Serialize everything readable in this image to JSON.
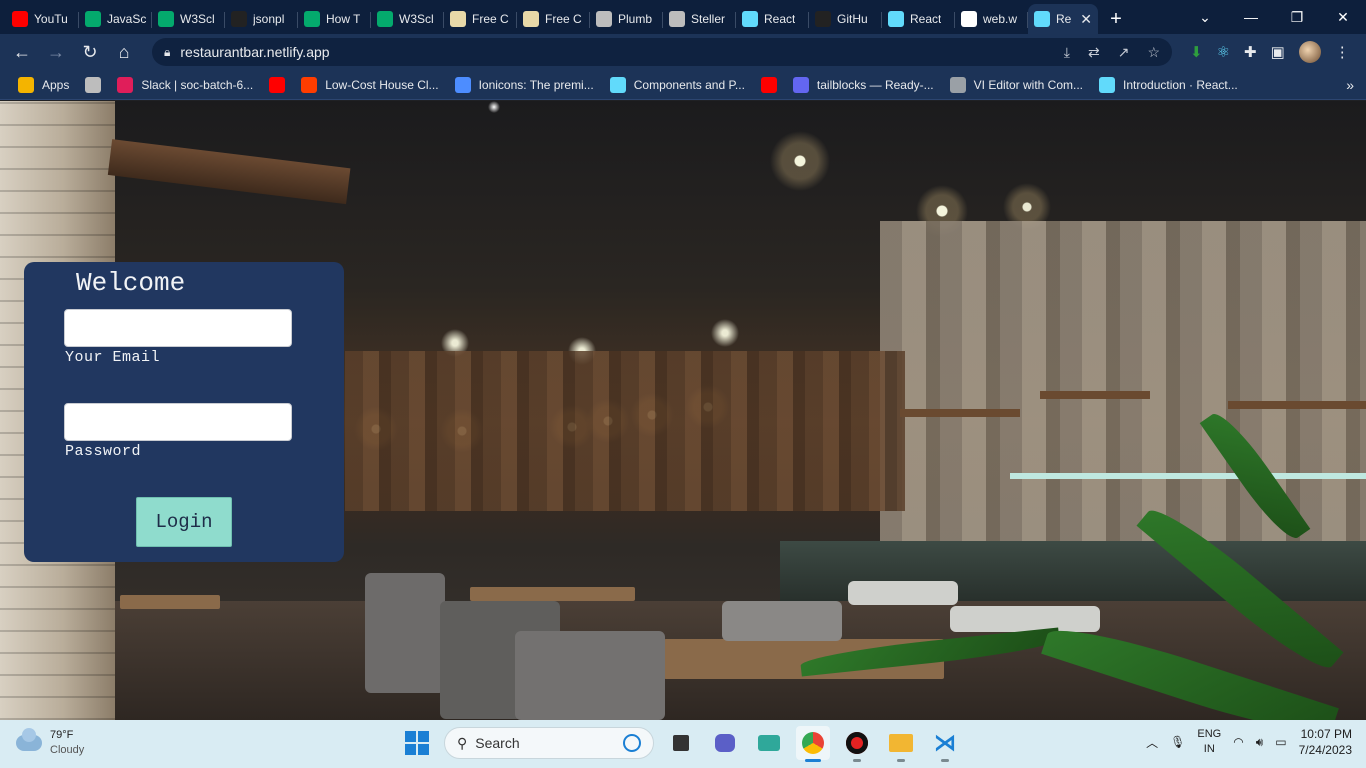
{
  "browser": {
    "tabs": [
      {
        "label": "YouTu",
        "icon": "youtube-icon",
        "color": "#ff0000"
      },
      {
        "label": "JavaSc",
        "icon": "w3schools-icon",
        "color": "#04aa6d"
      },
      {
        "label": "W3Scl",
        "icon": "w3schools-icon",
        "color": "#04aa6d"
      },
      {
        "label": "jsonpl",
        "icon": "jsonplaceholder-icon",
        "color": "#222222"
      },
      {
        "label": "How T",
        "icon": "w3schools-icon",
        "color": "#04aa6d"
      },
      {
        "label": "W3Scl",
        "icon": "w3schools-icon",
        "color": "#04aa6d"
      },
      {
        "label": "Free C",
        "icon": "page-icon",
        "color": "#e8d9a8"
      },
      {
        "label": "Free C",
        "icon": "page-icon",
        "color": "#e8d9a8"
      },
      {
        "label": "Plumb",
        "icon": "globe-icon",
        "color": "#bdbdbd"
      },
      {
        "label": "Steller",
        "icon": "globe-icon",
        "color": "#bdbdbd"
      },
      {
        "label": "React",
        "icon": "react-icon",
        "color": "#61dafb"
      },
      {
        "label": "GitHu",
        "icon": "github-icon",
        "color": "#222222"
      },
      {
        "label": "React",
        "icon": "react-icon",
        "color": "#61dafb"
      },
      {
        "label": "web.w",
        "icon": "google-icon",
        "color": "#ffffff"
      }
    ],
    "active_tab": {
      "label": "Re",
      "icon": "react-icon",
      "color": "#61dafb"
    },
    "new_tab": "+",
    "url": "restaurantbar.netlify.app",
    "bookmarks": [
      {
        "label": "Apps",
        "icon": "apps-grid-icon",
        "color": "#f4b400"
      },
      {
        "label": "",
        "icon": "globe-icon",
        "color": "#bdbdbd"
      },
      {
        "label": "Slack | soc-batch-6...",
        "icon": "slack-icon",
        "color": "#e01e5a"
      },
      {
        "label": "",
        "icon": "youtube-icon",
        "color": "#ff0000"
      },
      {
        "label": "Low-Cost House Cl...",
        "icon": "clone-icon",
        "color": "#ff3d00"
      },
      {
        "label": "Ionicons: The premi...",
        "icon": "ionicons-icon",
        "color": "#4d8dff"
      },
      {
        "label": "Components and P...",
        "icon": "react-icon",
        "color": "#61dafb"
      },
      {
        "label": "",
        "icon": "youtube-icon",
        "color": "#ff0000"
      },
      {
        "label": "tailblocks — Ready-...",
        "icon": "tailblocks-icon",
        "color": "#6366f1"
      },
      {
        "label": "VI Editor with Com...",
        "icon": "vi-icon",
        "color": "#9aa0a6"
      },
      {
        "label": "Introduction · React...",
        "icon": "react-icon",
        "color": "#61dafb"
      }
    ],
    "bookmarks_more": "»"
  },
  "login": {
    "title": "Welcome",
    "email_label": "Your Email",
    "email_value": "",
    "password_label": "Password",
    "password_value": "",
    "button_label": "Login"
  },
  "taskbar": {
    "weather_temp": "79°F",
    "weather_desc": "Cloudy",
    "search_placeholder": "Search",
    "lang_top": "ENG",
    "lang_bottom": "IN",
    "time": "10:07 PM",
    "date": "7/24/2023"
  },
  "colors": {
    "card_bg": "#213760",
    "button_bg": "#8fdccd",
    "chrome_bg": "#1c3357"
  }
}
